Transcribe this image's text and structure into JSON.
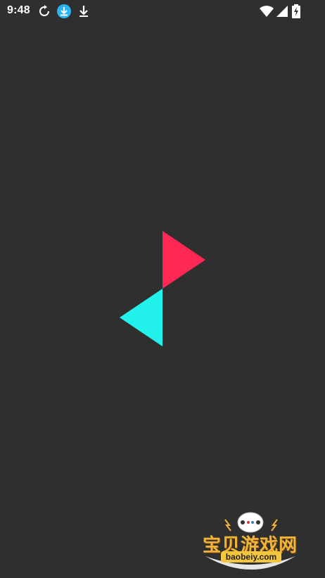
{
  "status_bar": {
    "time": "9:48",
    "icons": [
      "sync-icon",
      "download-badge-icon",
      "download-icon",
      "wifi-icon",
      "signal-icon",
      "battery-charging-icon"
    ]
  },
  "colors": {
    "background": "#2f2f2f",
    "logo_top": "#ff2855",
    "logo_bottom": "#22f0ea",
    "download_badge": "#2ab4f2"
  },
  "watermark": {
    "title": "宝贝游戏网",
    "domain": "baobeiy.com"
  }
}
